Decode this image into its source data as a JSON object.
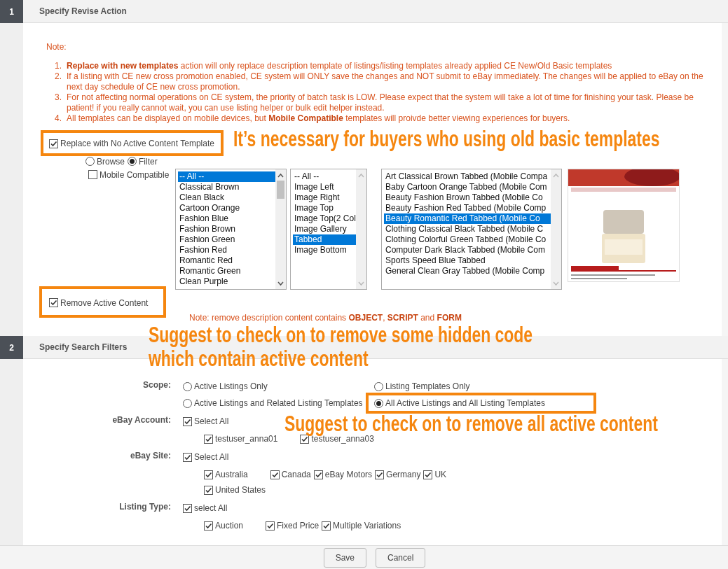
{
  "step1": {
    "number": "1",
    "title": "Specify Revise Action"
  },
  "note": {
    "label": "Note:",
    "items": [
      {
        "marker": "1.",
        "text": "**Replace with new templates** action will only replace description template of listings/listing templates already applied CE New/Old Basic templates"
      },
      {
        "marker": "2.",
        "text": "If a listing with CE new cross promotion enabled, CE system will ONLY save the changes and NOT submit to eBay immediately. The changes will be applied to eBay on the next day schedule of CE new cross promotion."
      },
      {
        "marker": "3.",
        "text": "For not affecting normal operations on CE system, the priority of batch task is LOW. Please expect that the system will take a lot of time for finishing your task. Please be patient! if you really cannot wait, you can use listing helper or bulk edit helper instead."
      },
      {
        "marker": "4.",
        "text": "All templates can be displayed on mobile devices, but **Mobile Compatible** templates will proivde better viewing experiences for buyers."
      }
    ]
  },
  "replace_option": {
    "label": "Replace with No Active Content Template",
    "checked": true
  },
  "view_mode": [
    {
      "label": "Browse",
      "selected": false
    },
    {
      "label": "Filter",
      "selected": true
    }
  ],
  "mobile_compatible": {
    "label": "Mobile Compatible",
    "checked": false
  },
  "style_list": [
    {
      "label": "-- All --",
      "selected": true
    },
    {
      "label": "Classical Brown",
      "selected": false
    },
    {
      "label": "Clean Black",
      "selected": false
    },
    {
      "label": "Cartoon Orange",
      "selected": false
    },
    {
      "label": "Fashion Blue",
      "selected": false
    },
    {
      "label": "Fashion Brown",
      "selected": false
    },
    {
      "label": "Fashion Green",
      "selected": false
    },
    {
      "label": "Fashion Red",
      "selected": false
    },
    {
      "label": "Romantic Red",
      "selected": false
    },
    {
      "label": "Romantic Green",
      "selected": false
    },
    {
      "label": "Clean Purple",
      "selected": false
    }
  ],
  "layout_list": [
    {
      "label": "-- All --",
      "selected": false
    },
    {
      "label": "Image Left",
      "selected": false
    },
    {
      "label": "Image Right",
      "selected": false
    },
    {
      "label": "Image Top",
      "selected": false
    },
    {
      "label": "Image Top(2 Col",
      "selected": false
    },
    {
      "label": "Image Gallery",
      "selected": false
    },
    {
      "label": "Tabbed",
      "selected": true
    },
    {
      "label": "Image Bottom",
      "selected": false
    }
  ],
  "template_list": [
    {
      "label": "Art Classical Brown Tabbed (Mobile Compa",
      "selected": false
    },
    {
      "label": "Baby Cartoon Orange Tabbed (Mobile Com",
      "selected": false
    },
    {
      "label": "Beauty Fashion Brown Tabbed (Mobile Co",
      "selected": false
    },
    {
      "label": "Beauty Fashion Red Tabbed (Mobile Comp",
      "selected": false
    },
    {
      "label": "Beauty Romantic Red Tabbed (Mobile Co",
      "selected": true
    },
    {
      "label": "Clothing Classical Black Tabbed (Mobile C",
      "selected": false
    },
    {
      "label": "Clothing Colorful Green Tabbed (Mobile Co",
      "selected": false
    },
    {
      "label": "Computer Dark Black Tabbed (Mobile Com",
      "selected": false
    },
    {
      "label": "Sports Speed Blue Tabbed",
      "selected": false
    },
    {
      "label": "General Clean Gray Tabbed (Mobile Comp",
      "selected": false
    }
  ],
  "preview": {
    "kind": "picture"
  },
  "remove_option": {
    "label": "Remove Active Content",
    "checked": true
  },
  "remove_note": "Note: remove description content contains **OBJECT**, **SCRIPT** and **FORM**",
  "step2": {
    "number": "2",
    "title": "Specify Search Filters"
  },
  "scope": {
    "label": "Scope:",
    "options": [
      {
        "label": "Active Listings Only",
        "selected": false
      },
      {
        "label": "Listing Templates Only",
        "selected": false
      },
      {
        "label": "Active Listings and Related Listing Templates",
        "selected": false
      },
      {
        "label": "All Active Listings and All Listing Templates",
        "selected": true
      }
    ]
  },
  "filters": [
    {
      "label": "eBay Account:",
      "select_all": {
        "label": "Select All",
        "checked": true
      },
      "options": [
        {
          "label": "testuser_anna01",
          "checked": true
        },
        {
          "label": "testuser_anna03",
          "checked": true
        }
      ]
    },
    {
      "label": "eBay Site:",
      "select_all": {
        "label": "Select All",
        "checked": true
      },
      "options": [
        {
          "label": "Australia",
          "checked": true
        },
        {
          "label": "Canada",
          "checked": true
        },
        {
          "label": "eBay Motors",
          "checked": true
        },
        {
          "label": "Germany",
          "checked": true
        },
        {
          "label": "UK",
          "checked": true
        },
        {
          "label": "United States",
          "checked": true
        }
      ]
    },
    {
      "label": "Listing Type:",
      "select_all": {
        "label": "select All",
        "checked": true
      },
      "options": [
        {
          "label": "Auction",
          "checked": true
        },
        {
          "label": "Fixed Price",
          "checked": true
        },
        {
          "label": "Multiple Variations",
          "checked": true
        }
      ]
    }
  ],
  "buttons": [
    "Save",
    "Cancel"
  ],
  "callouts": [
    "It’s necessary for buyers who using old basic templates",
    "Suggest to check on to remove some hidden code which contain active content",
    "Suggest to check on to remove all active content"
  ]
}
